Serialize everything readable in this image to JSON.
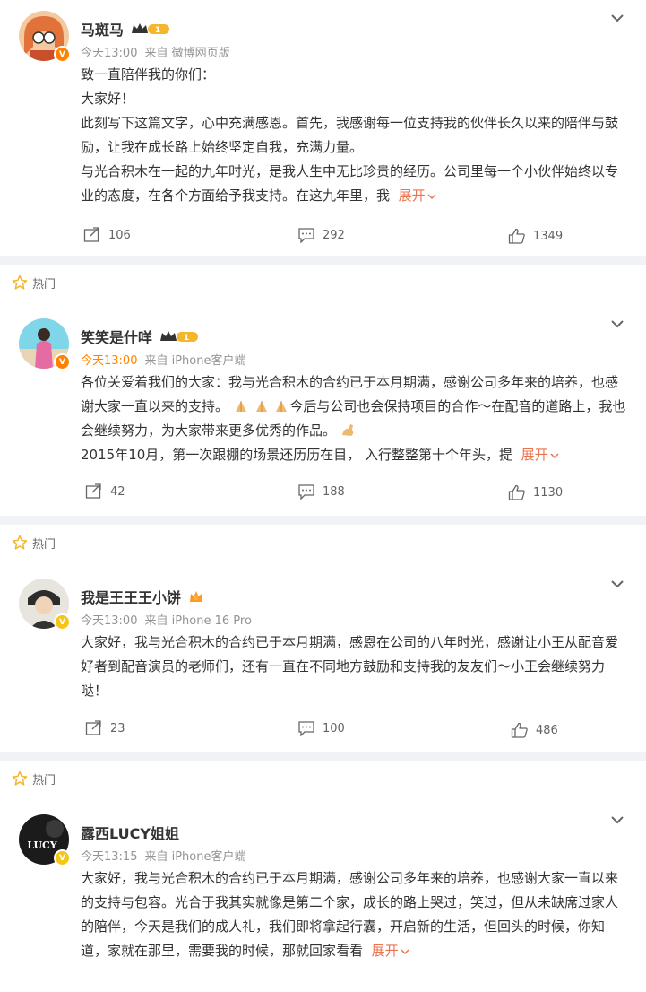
{
  "posts": [
    {
      "hot": false,
      "name": "马斑马",
      "level": "1",
      "time": "今天13:00",
      "time_highlight": false,
      "source": "来自 微博网页版",
      "paragraphs": [
        "致一直陪伴我的你们：",
        "大家好！",
        "此刻写下这篇文字，心中充满感恩。首先，我感谢每一位支持我的伙伴长久以来的陪伴与鼓励，让我在成长路上始终坚定自我，充满力量。",
        "与光合积木在一起的九年时光，是我人生中无比珍贵的经历。公司里每一个小伙伴始终以专业的态度，在各个方面给予我支持。在这九年里，我"
      ],
      "expand": "展开",
      "repost": "106",
      "comment": "292",
      "like": "1349"
    },
    {
      "hot": true,
      "hot_label": "热门",
      "name": "笑笑是什咩",
      "level": "1",
      "time": "今天13:00",
      "time_highlight": true,
      "source": "来自 iPhone客户端",
      "p1": "各位关爱着我们的大家：我与光合积木的合约已于本月期满，感谢公司多年来的培养，也感谢大家一直以来的支持。",
      "p1b": "今后与公司也会保持项目的合作～在配音的道路上，我也会继续努力，为大家带来更多优秀的作品。",
      "p2": "2015年10月，第一次跟棚的场景还历历在目， 入行整整第十个年头，提",
      "expand": "展开",
      "repost": "42",
      "comment": "188",
      "like": "1130"
    },
    {
      "hot": true,
      "hot_label": "热门",
      "name": "我是王王王小饼",
      "time": "今天13:00",
      "time_highlight": false,
      "source": "来自 iPhone 16 Pro",
      "paragraphs": [
        "大家好，我与光合积木的合约已于本月期满，感恩在公司的八年时光，感谢让小王从配音爱好者到配音演员的老师们，还有一直在不同地方鼓励和支持我的友友们～小王会继续努力哒！"
      ],
      "repost": "23",
      "comment": "100",
      "like": "486"
    },
    {
      "hot": true,
      "hot_label": "热门",
      "name": "露西LUCY姐姐",
      "avatar_text": "LUCY",
      "time": "今天13:15",
      "time_highlight": false,
      "source": "来自 iPhone客户端",
      "paragraphs": [
        "大家好，我与光合积木的合约已于本月期满，感谢公司多年来的培养，也感谢大家一直以来的支持与包容。光合于我其实就像是第二个家，成长的路上哭过，笑过，但从未缺席过家人的陪伴，今天是我们的成人礼，我们即将拿起行囊，开启新的生活，但回头的时候，你知道，家就在那里，需要我的时候，那就回家看看"
      ],
      "expand": "展开"
    }
  ]
}
